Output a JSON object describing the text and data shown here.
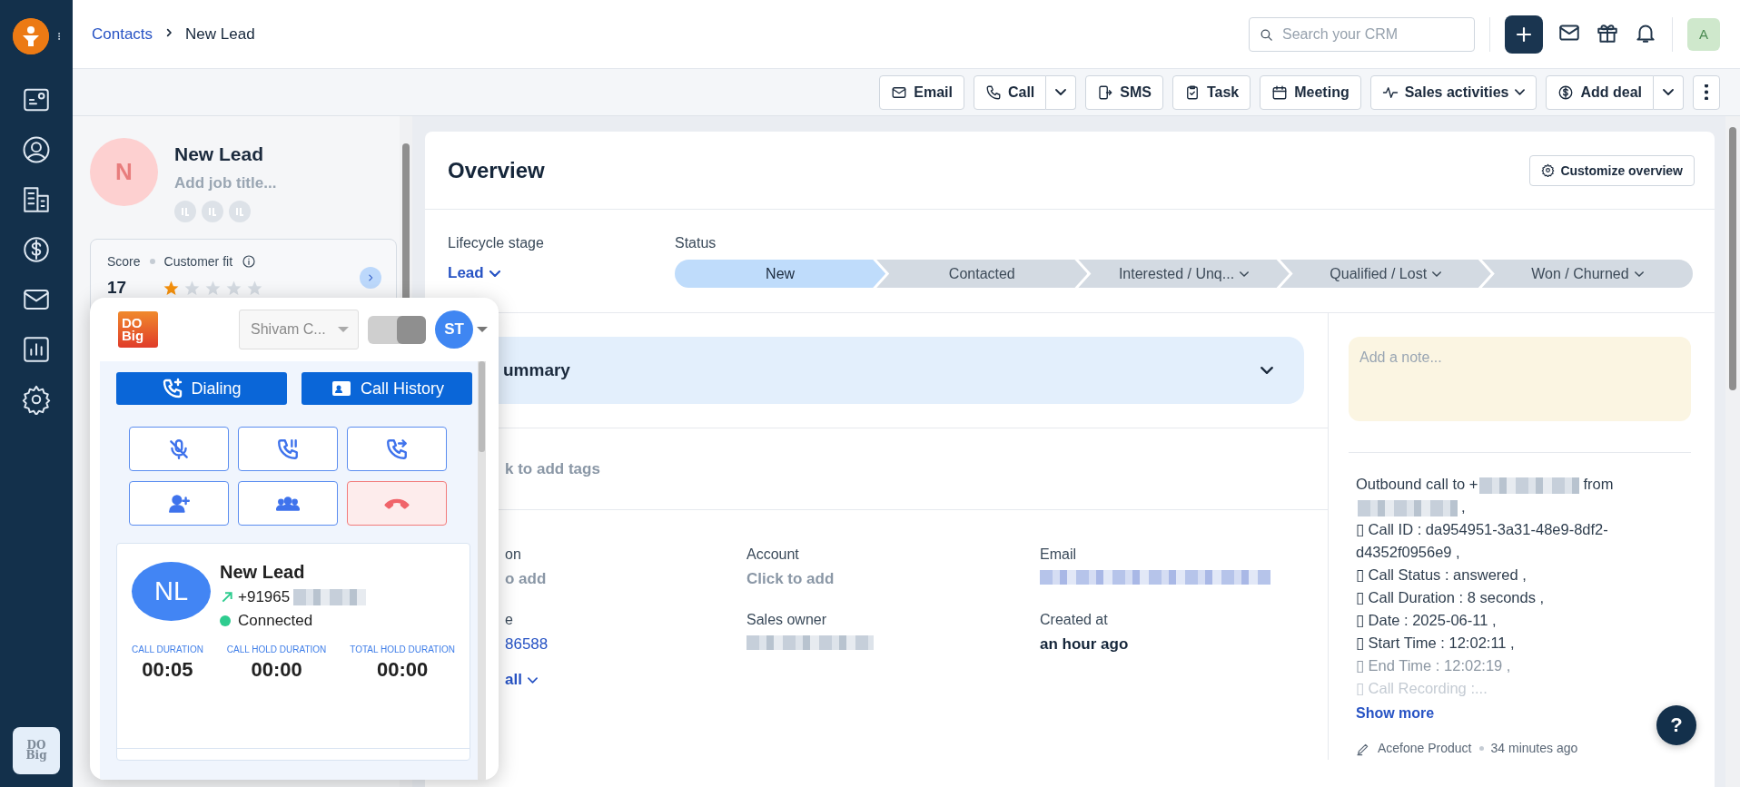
{
  "app_tile": {
    "lines": [
      "DO",
      "Big"
    ]
  },
  "breadcrumb": {
    "parent": "Contacts",
    "current": "New Lead"
  },
  "search": {
    "placeholder": "Search your CRM"
  },
  "user_avatar": {
    "initial": "A"
  },
  "toolbar": {
    "buttons": [
      {
        "label": "Email",
        "kind": "plain"
      },
      {
        "label": "Call",
        "kind": "split"
      },
      {
        "label": "SMS",
        "kind": "plain"
      },
      {
        "label": "Task",
        "kind": "plain"
      },
      {
        "label": "Meeting",
        "kind": "plain"
      },
      {
        "label": "Sales activities",
        "kind": "dropdown"
      },
      {
        "label": "Add deal",
        "kind": "split"
      },
      {
        "kind": "more"
      }
    ]
  },
  "profile": {
    "initial": "N",
    "name": "New Lead",
    "job_title_placeholder": "Add job title...",
    "score_label": "Score",
    "fit_label": "Customer fit",
    "score": "17",
    "stars": 1
  },
  "overview": {
    "title": "Overview",
    "customize": "Customize overview",
    "lifecycle_label": "Lifecycle stage",
    "lifecycle": "Lead",
    "status_label": "Status",
    "stages": [
      {
        "label": "New",
        "selected": true,
        "dropdown": false
      },
      {
        "label": "Contacted",
        "selected": false,
        "dropdown": false
      },
      {
        "label": "Interested / Unq...",
        "selected": false,
        "dropdown": true
      },
      {
        "label": "Qualified / Lost",
        "selected": false,
        "dropdown": true
      },
      {
        "label": "Won / Churned",
        "selected": false,
        "dropdown": true
      }
    ]
  },
  "summary": {
    "title": "ummary"
  },
  "tags": {
    "placeholder": "k to add tags"
  },
  "fields": [
    {
      "label": "on",
      "placeholder": "o add",
      "kind": "empty"
    },
    {
      "label": "Account",
      "placeholder": "Click to add",
      "kind": "empty"
    },
    {
      "label": "Email",
      "kind": "redacted"
    },
    {
      "label": "e",
      "value": "86588",
      "kind": "link"
    },
    {
      "label": "Sales owner",
      "kind": "redacted"
    },
    {
      "label": "Created at",
      "value": "an hour ago",
      "kind": "strong"
    }
  ],
  "view_all": "all",
  "note": {
    "placeholder": "Add a note..."
  },
  "activity": {
    "lines": [
      {
        "kind": "normal",
        "segments": [
          {
            "kind": "text",
            "text": "Outbound call to +"
          },
          {
            "kind": "redacted"
          },
          {
            "kind": "text",
            "text": "from"
          }
        ]
      },
      {
        "kind": "normal",
        "segments": [
          {
            "kind": "redacted"
          },
          {
            "kind": "text",
            "text": ","
          }
        ]
      },
      {
        "kind": "normal",
        "segments": [
          {
            "kind": "text",
            "text": "▯ Call ID : da954951-3a31-48e9-8df2-d4352f0956e9 ,"
          }
        ]
      },
      {
        "kind": "normal",
        "segments": [
          {
            "kind": "text",
            "text": "▯ Call Status : answered ,"
          }
        ]
      },
      {
        "kind": "normal",
        "segments": [
          {
            "kind": "text",
            "text": "▯ Call Duration : 8 seconds ,"
          }
        ]
      },
      {
        "kind": "normal",
        "segments": [
          {
            "kind": "text",
            "text": "▯ Date : 2025-06-11 ,"
          }
        ]
      },
      {
        "kind": "normal",
        "segments": [
          {
            "kind": "text",
            "text": "▯ Start Time : 12:02:11 ,"
          }
        ]
      },
      {
        "kind": "faded",
        "segments": [
          {
            "kind": "text",
            "text": "▯ End Time : 12:02:19 ,"
          }
        ]
      },
      {
        "kind": "fainter",
        "segments": [
          {
            "kind": "text",
            "text": "▯ Call Recording :..."
          }
        ]
      }
    ],
    "show_more": "Show more",
    "author": "Acefone Product",
    "time": "34 minutes ago"
  },
  "help": {
    "label": "?"
  },
  "dialer": {
    "logo": [
      "DO",
      "Big"
    ],
    "agent": "Shivam C...",
    "toggle_on": true,
    "agent_initials": "ST",
    "tabs": [
      {
        "label": "Dialing"
      },
      {
        "label": "Call History"
      }
    ],
    "controls": [
      {
        "kind": "normal"
      },
      {
        "kind": "normal"
      },
      {
        "kind": "normal"
      },
      {
        "kind": "normal"
      },
      {
        "kind": "normal"
      },
      {
        "kind": "danger"
      }
    ],
    "call": {
      "initials": "NL",
      "name": "New Lead",
      "number": "+91965",
      "status": "Connected",
      "stats": [
        {
          "label": "CALL DURATION",
          "value": "00:05"
        },
        {
          "label": "CALL HOLD DURATION",
          "value": "00:00"
        },
        {
          "label": "TOTAL HOLD DURATION",
          "value": "00:00"
        }
      ]
    }
  }
}
